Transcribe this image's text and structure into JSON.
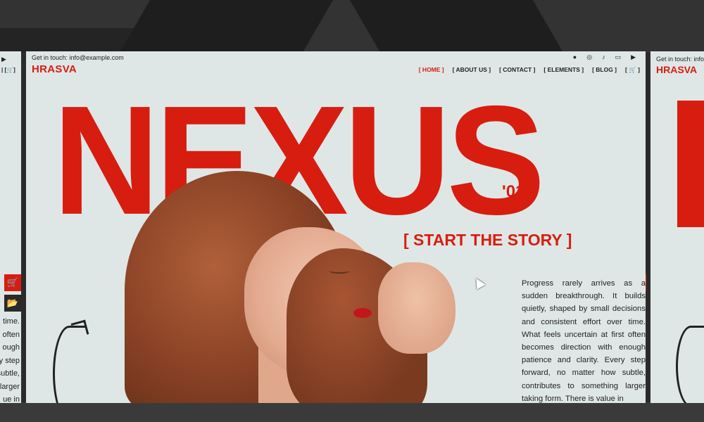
{
  "site": {
    "contact": "Get in touch: info@example.com",
    "logo": "HRASVA"
  },
  "social_icons": [
    "facebook-icon",
    "instagram-icon",
    "tiktok-icon",
    "twitch-icon",
    "youtube-icon"
  ],
  "nav": {
    "home": "[ HOME ]",
    "about": "[ ABOUT US ]",
    "contact": "[ CONTACT ]",
    "elements": "[ ELEMENTS ]",
    "blog": "[ BLOG ]",
    "cart": "[ 🛒 ]"
  },
  "hero": {
    "title": "NEXUS",
    "issue": "'01",
    "tagline": "[ START THE STORY ]",
    "body": "Progress rarely arrives as a sudden breakthrough. It builds quietly, shaped by small decisions and consistent effort over time. What feels uncertain at first often becomes direction with enough patience and clarity. Every step forward, no matter how subtle, contributes to something larger taking form. There is value in"
  },
  "left_panel": {
    "nav_fragment": "| [🛒]",
    "text_lines": [
      "time.",
      "often",
      "ough",
      "y step",
      "subtle,",
      "larger",
      "ue in"
    ]
  },
  "right_panel": {
    "contact": "Get in touch: info",
    "logo": "HRASVA"
  },
  "colors": {
    "accent": "#d71d10",
    "background": "#dfe7e6",
    "text": "#222222"
  }
}
